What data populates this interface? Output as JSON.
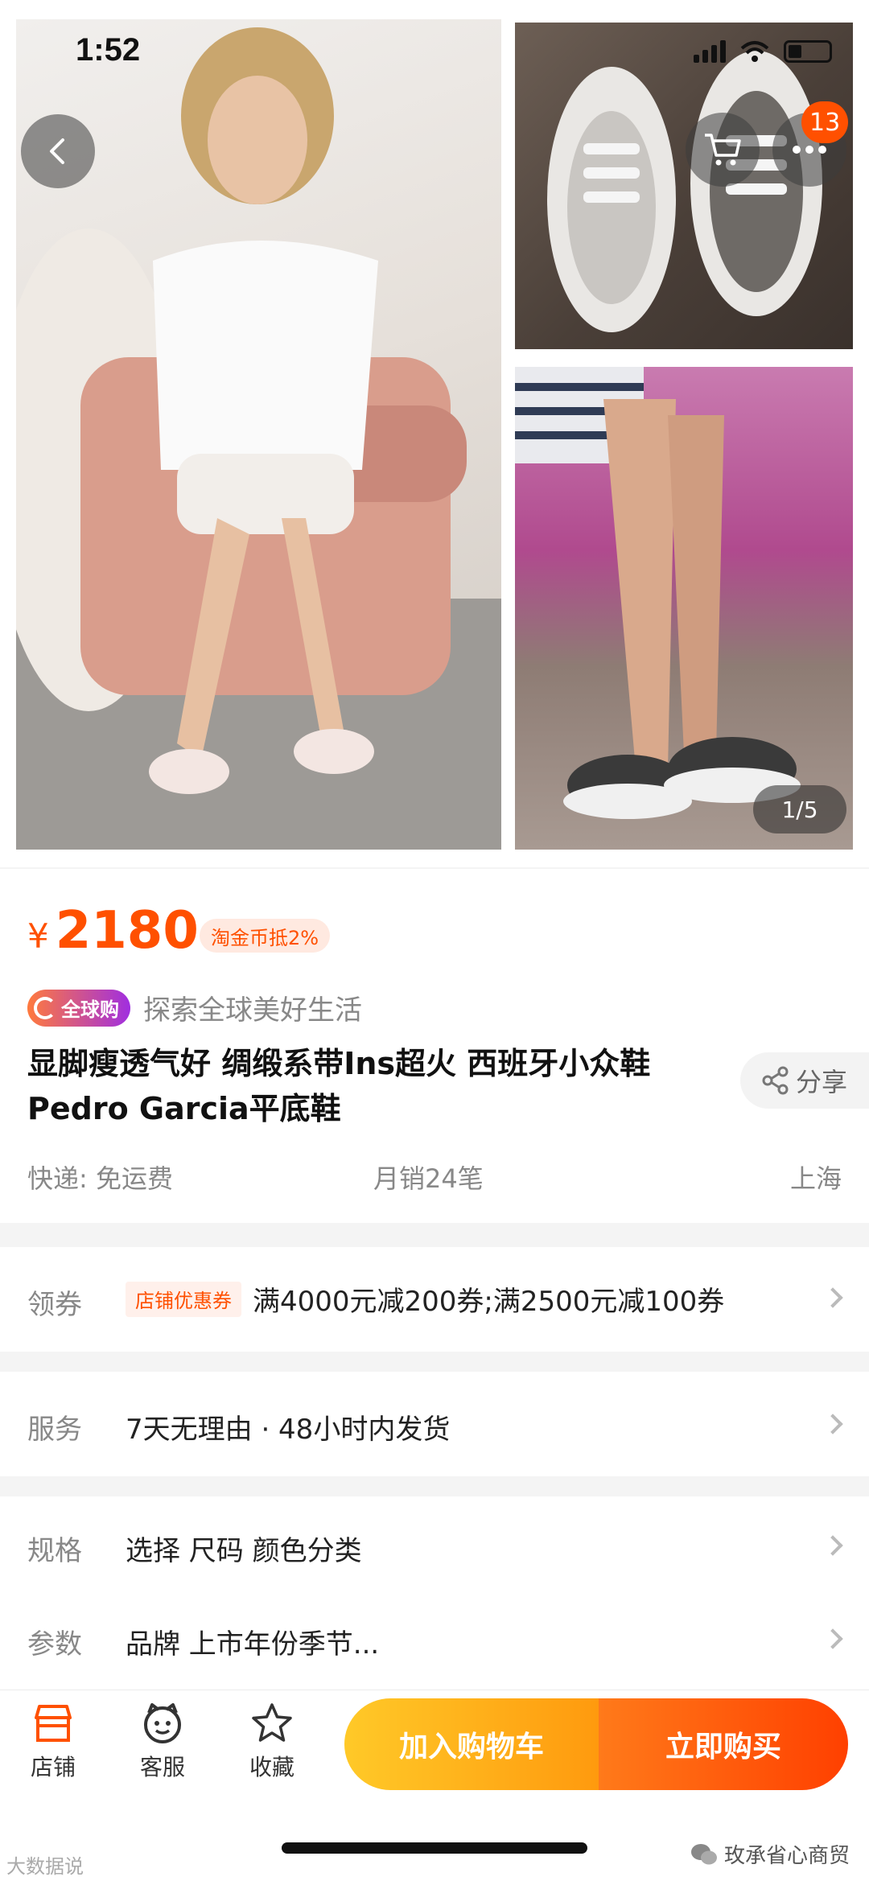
{
  "status": {
    "time": "1:52"
  },
  "gallery": {
    "cart_badge": "13",
    "page_indicator": "1/5"
  },
  "product": {
    "currency": "¥",
    "price": "2180",
    "coin_tag": "淘金币抵2%",
    "global_badge": "全球购",
    "global_slogan": "探索全球美好生活",
    "title": "显脚瘦透气好 绸缎系带Ins超火 西班牙小众鞋 Pedro Garcia平底鞋",
    "share_label": "分享",
    "shipping": "快递: 免运费",
    "monthly_sales": "月销24笔",
    "location": "上海"
  },
  "options": {
    "coupon": {
      "label": "领券",
      "tag": "店铺优惠券",
      "value": "满4000元减200券;满2500元减100券"
    },
    "service": {
      "label": "服务",
      "value": "7天无理由 · 48小时内发货"
    },
    "spec": {
      "label": "规格",
      "value": "选择  尺码 颜色分类"
    },
    "params": {
      "label": "参数",
      "value": "品牌 上市年份季节..."
    }
  },
  "bottombar": {
    "shop": "店铺",
    "service": "客服",
    "favorite": "收藏",
    "add_to_cart": "加入购物车",
    "buy_now": "立即购买"
  },
  "watermarks": {
    "left": "大数据说",
    "right": "玫承省心商贸"
  },
  "colors": {
    "accent": "#ff5000",
    "cart_button": "#ffb31a",
    "buy_button": "#ff5a0d"
  }
}
